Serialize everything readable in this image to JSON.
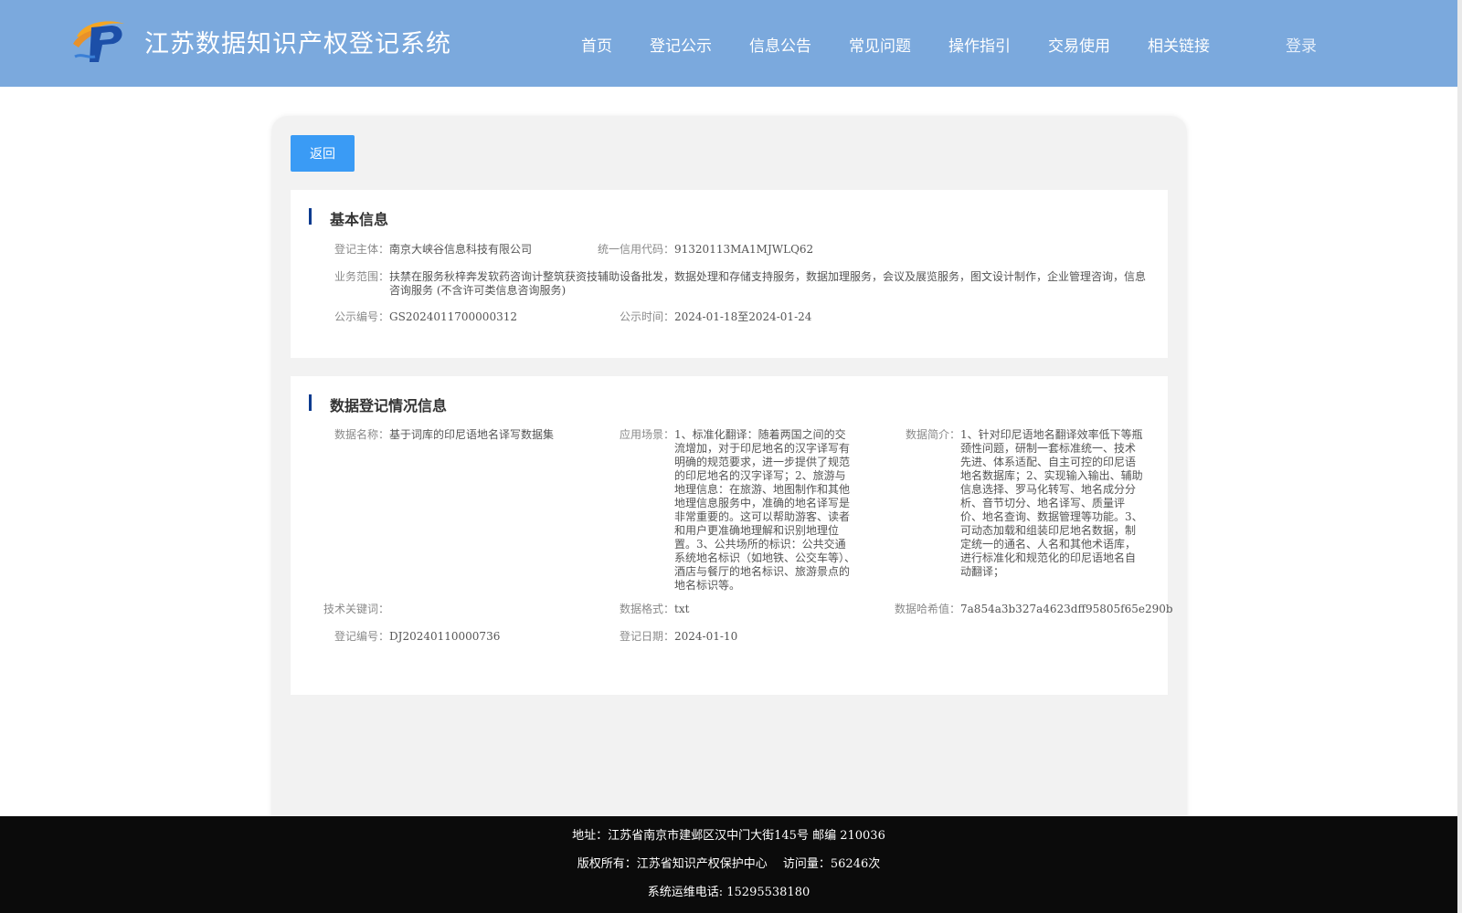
{
  "header": {
    "site_title": "江苏数据知识产权登记系统",
    "logo_icon": "jiangsu-ip-logo",
    "nav": [
      "首页",
      "登记公示",
      "信息公告",
      "常见问题",
      "操作指引",
      "交易使用",
      "相关链接"
    ],
    "login_label": "登录"
  },
  "toolbar": {
    "back_label": "返回"
  },
  "basic_info": {
    "title": "基本信息",
    "subject_label": "登记主体：",
    "subject_value": "南京大峡谷信息科技有限公司",
    "credit_code_label": "统一信用代码：",
    "credit_code_value": "91320113MA1MJWLQ62",
    "scope_label": "业务范围：",
    "scope_value": "扶禁在服务秋梓奔发软药咨询计整筑获资技辅助设备批发，数据处理和存储支持服务，数据加理服务，会议及展览服务，图文设计制作，企业管理咨询，信息咨询服务 (不含许可类信息咨询服务)",
    "pub_no_label": "公示编号：",
    "pub_no_value": "GS2024011700000312",
    "pub_time_label": "公示时间：",
    "pub_time_value": "2024-01-18至2024-01-24"
  },
  "registration_info": {
    "title": "数据登记情况信息",
    "data_name_label": "数据名称：",
    "data_name_value": "基于词库的印尼语地名译写数据集",
    "scenario_label": "应用场景：",
    "scenario_value": "1、标准化翻译：随着两国之间的交流增加，对于印尼地名的汉字译写有明确的规范要求，进一步提供了规范的印尼地名的汉字译写；2、旅游与地理信息：在旅游、地图制作和其他地理信息服务中，准确的地名译写是非常重要的。这可以帮助游客、读者和用户更准确地理解和识别地理位置。3、公共场所的标识：公共交通系统地名标识（如地铁、公交车等）、酒店与餐厅的地名标识、旅游景点的地名标识等。",
    "intro_label": "数据简介：",
    "intro_value": "1、针对印尼语地名翻译效率低下等瓶颈性问题，研制一套标准统一、技术先进、体系适配、自主可控的印尼语地名数据库；2、实现输入输出、辅助信息选择、罗马化转写、地名成分分析、音节切分、地名译写、质量评价、地名查询、数据管理等功能。3、可动态加载和组装印尼地名数据，制定统一的通名、人名和其他术语库，进行标准化和规范化的印尼语地名自动翻译；",
    "keywords_label": "技术关键词：",
    "keywords_value": "",
    "format_label": "数据格式：",
    "format_value": "txt",
    "hash_label": "数据哈希值：",
    "hash_value": "7a854a3b327a4623dff95805f65e290b",
    "reg_no_label": "登记编号：",
    "reg_no_value": "DJ20240110000736",
    "reg_date_label": "登记日期：",
    "reg_date_value": "2024-01-10"
  },
  "footer": {
    "address": "地址：江苏省南京市建邺区汉中门大街145号 邮编 210036",
    "copyright": "版权所有：江苏省知识产权保护中心　 访问量：56246次",
    "phone": "系统运维电话: 15295538180"
  },
  "colors": {
    "header_bg": "#7ba9dd",
    "accent": "#3a9bf5",
    "section_bar": "#0d3b8f",
    "footer_bg": "#0b0b0b"
  }
}
